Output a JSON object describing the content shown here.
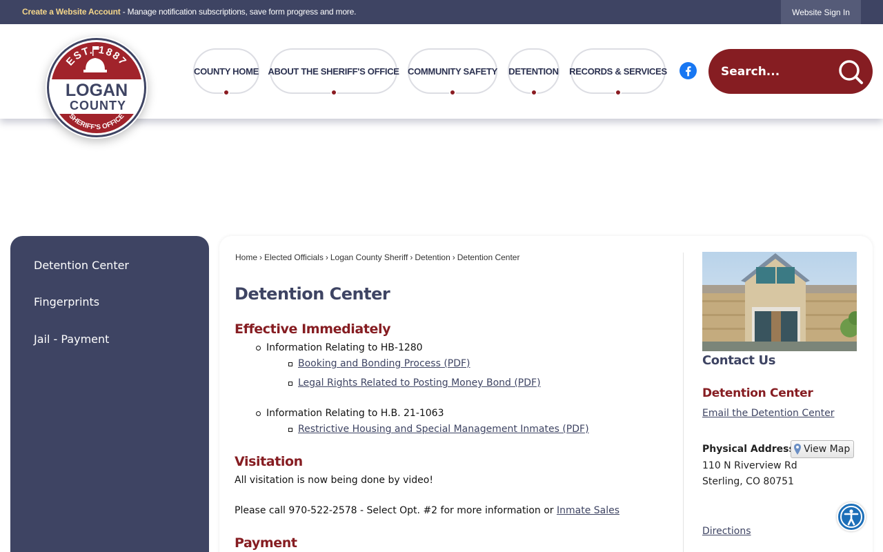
{
  "topbar": {
    "create_account": "Create a Website Account",
    "create_account_rest": " - Manage notification subscriptions, save form progress and more.",
    "sign_in": "Website Sign In"
  },
  "logo": {
    "est": "EST. 1887",
    "line1": "LOGAN",
    "line2": "COUNTY",
    "line3": "SHERIFF'S OFFICE"
  },
  "nav": {
    "items": [
      {
        "label": "COUNTY HOME"
      },
      {
        "label": "ABOUT THE SHERIFF'S OFFICE"
      },
      {
        "label": "COMMUNITY SAFETY"
      },
      {
        "label": "DETENTION"
      },
      {
        "label": "RECORDS & SERVICES"
      }
    ]
  },
  "search": {
    "placeholder": "Search..."
  },
  "sidebar": {
    "items": [
      {
        "label": "Detention Center"
      },
      {
        "label": "Fingerprints"
      },
      {
        "label": "Jail - Payment"
      }
    ]
  },
  "breadcrumb": [
    "Home",
    "Elected Officials",
    "Logan County Sheriff",
    "Detention",
    "Detention Center"
  ],
  "page_title": "Detention Center",
  "sections": {
    "effective": {
      "heading": "Effective Immediately",
      "item1": "Information Relating to HB-1280",
      "item1_links": [
        "Booking and Bonding Process (PDF)",
        "Legal Rights Related to Posting Money Bond (PDF)"
      ],
      "item2": "Information Relating to H.B. 21-1063",
      "item2_links": [
        "Restrictive Housing and Special Management Inmates (PDF)"
      ]
    },
    "visitation": {
      "heading": "Visitation",
      "line1": "All visitation is now being done by video!",
      "line2": "Please call 970-522-2578 - Select Opt. #2 for more information or ",
      "link": "Inmate Sales"
    },
    "payment": {
      "heading": "Payment"
    }
  },
  "contact": {
    "heading": "Contact Us",
    "dept": "Detention Center",
    "email_link": "Email the Detention Center",
    "address_label": "Physical Address",
    "view_map": "View Map",
    "address_line1": "110 N Riverview Rd",
    "address_line2": "Sterling, CO 80751",
    "directions": "Directions"
  },
  "colors": {
    "navy": "#3e4463",
    "maroon": "#861d22",
    "facebook": "#1877f2"
  },
  "icons": {
    "facebook": "facebook-icon",
    "search": "search-icon",
    "map_pin": "map-pin-icon",
    "accessibility": "accessibility-icon"
  }
}
